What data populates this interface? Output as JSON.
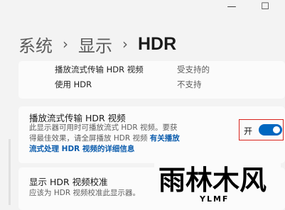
{
  "window": {
    "minimize_glyph": "—",
    "maximize_glyph": "☐"
  },
  "breadcrumb": {
    "level1": "系统",
    "level2": "显示",
    "current": "HDR",
    "separator": "›"
  },
  "info": {
    "rows": [
      {
        "label": "播放流式传输 HDR 视频",
        "value": "受支持的"
      },
      {
        "label": "使用 HDR",
        "value": "不支持"
      }
    ]
  },
  "streaming": {
    "title": "播放流式传输 HDR 视频",
    "desc_line1": "此显示器可用时可播放流式 HDR 视频。要获",
    "desc_line2_text": "得最佳效果，请全屏播放 HDR 视频 ",
    "desc_link_part1": "有关播放",
    "desc_link_part2": "流式处理 HDR 视频的详细信息",
    "toggle_label": "开",
    "toggle_state": "on",
    "accent_color": "#0067c0"
  },
  "calibration": {
    "title": "显示 HDR 视频校准",
    "desc": "应该为 HDR 视频校准此显示器。"
  },
  "watermark": {
    "text": "雨林木风",
    "sub": "YLMF"
  }
}
